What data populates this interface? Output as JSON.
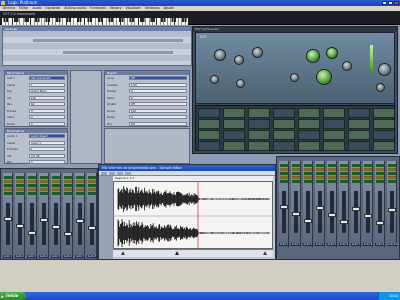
{
  "window": {
    "title": "Logic Platinum",
    "menu": [
      "Archivo",
      "Editar",
      "Audio",
      "Opciones",
      "Archivo audio",
      "Funciones",
      "Factory",
      "Visualizar",
      "Ventanas",
      "Ayuda"
    ]
  },
  "strip": {
    "label": "VST 2.0 Instrument"
  },
  "tracks_window": {
    "title": "Arrange"
  },
  "panels": {
    "left": {
      "title": "Parámetros",
      "rows": [
        {
          "label": "Inst 1",
          "value": "GM Instrument"
        },
        {
          "label": "Canal",
          "value": "1"
        },
        {
          "label": "Prg",
          "value": "Grand Piano"
        },
        {
          "label": "Vol",
          "value": "100"
        },
        {
          "label": "Pan",
          "value": "64"
        },
        {
          "label": "Transp",
          "value": "0"
        },
        {
          "label": "Veloc",
          "value": "0"
        },
        {
          "label": "Delay",
          "value": "0"
        }
      ]
    },
    "left2": {
      "title": "Parámetros",
      "rows": [
        {
          "label": "Audio 1",
          "value": "Audio Object"
        },
        {
          "label": "Canal",
          "value": "Audio 1"
        },
        {
          "label": "Entrada",
          "value": "1"
        },
        {
          "label": "Vol",
          "value": "0.0 dB"
        },
        {
          "label": "Pan",
          "value": "0"
        },
        {
          "label": "Salida",
          "value": "Out 1-2"
        }
      ]
    },
    "mid": {
      "title": "Región",
      "rows": [
        {
          "label": "Loop",
          "value": "Off"
        },
        {
          "label": "Cuantiz",
          "value": "1/16"
        },
        {
          "label": "Transp",
          "value": "0"
        },
        {
          "label": "Veloc",
          "value": "0"
        },
        {
          "label": "Dinám",
          "value": "Off"
        },
        {
          "label": "Durac",
          "value": "100"
        },
        {
          "label": "Delay",
          "value": "0"
        },
        {
          "label": "Poli",
          "value": "Off"
        }
      ]
    }
  },
  "synth": {
    "title": "ES2 Synthesizer",
    "face_label": "ES2"
  },
  "editor": {
    "title": "Mis Informes de programador.wav - Sample Editor",
    "ruler": "Regions 1   2   3"
  },
  "mixer_left": {
    "strips": [
      "Audio 1",
      "Audio 2",
      "Audio 3",
      "Audio 4",
      "Audio 5",
      "Audio 6",
      "Audio 7",
      "Audio 8"
    ]
  },
  "mixer_right": {
    "strips": [
      "Audio 1",
      "Audio 2",
      "Audio 3",
      "Audio 4",
      "Audio 5",
      "Audio 6",
      "Audio 7",
      "Audio 8",
      "Audio 9",
      "Audio 10"
    ]
  },
  "taskbar": {
    "start": "Inicio",
    "clock": "18:04"
  },
  "colors": {
    "titlebar": "#2a5bd7",
    "synth_face": "#6f8aa1",
    "knob_green": "#4e9b3a"
  }
}
